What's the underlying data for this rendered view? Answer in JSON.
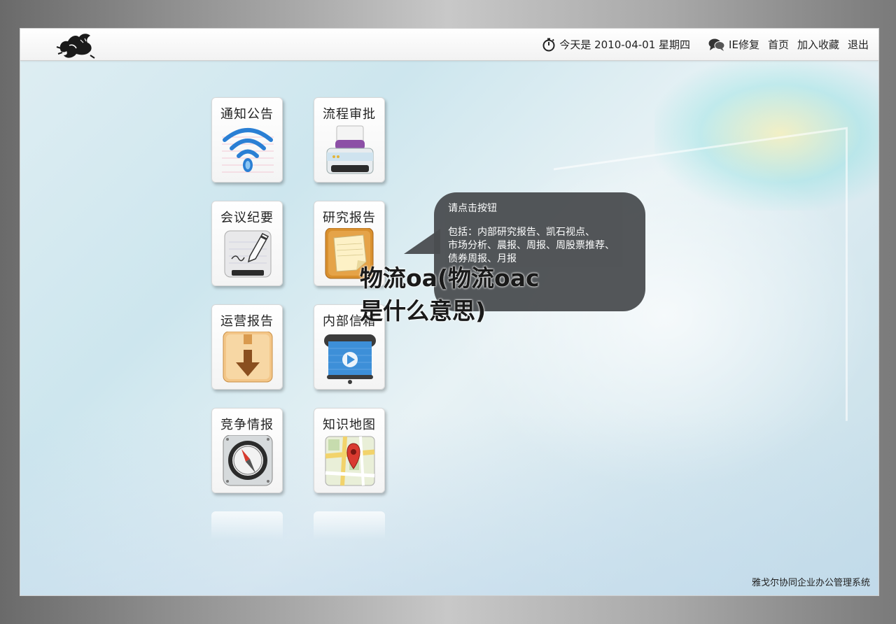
{
  "header": {
    "date_text": "今天是 2010-04-01 星期四",
    "links": {
      "ie_repair": "IE修复",
      "home": "首页",
      "favorite": "加入收藏",
      "logout": "退出"
    }
  },
  "tiles": [
    {
      "label": "通知公告",
      "icon": "wifi-signal-icon"
    },
    {
      "label": "流程审批",
      "icon": "printer-icon"
    },
    {
      "label": "会议纪要",
      "icon": "pen-notepad-icon"
    },
    {
      "label": "研究报告",
      "icon": "sticky-note-icon"
    },
    {
      "label": "运营报告",
      "icon": "download-box-icon"
    },
    {
      "label": "内部信箱",
      "icon": "video-player-icon"
    },
    {
      "label": "竞争情报",
      "icon": "compass-icon"
    },
    {
      "label": "知识地图",
      "icon": "map-pin-icon"
    }
  ],
  "tooltip": {
    "title": "请点击按钮",
    "body_lines": [
      "包括：内部研究报告、凯石视点、",
      "市场分析、晨报、周报、周股票推荐、",
      "债券周报、月报"
    ]
  },
  "overlay_text": {
    "line1": "物流oa(物流oac",
    "line2": "是什么意思)"
  },
  "footer": {
    "system_name": "雅戈尔协同企业办公管理系统"
  },
  "colors": {
    "tooltip_bg": "#4a4d50",
    "wifi_blue": "#2a7fd4",
    "printer_purple": "#8c4fa6",
    "note_orange": "#d9902e",
    "video_blue": "#3d8fd8"
  }
}
